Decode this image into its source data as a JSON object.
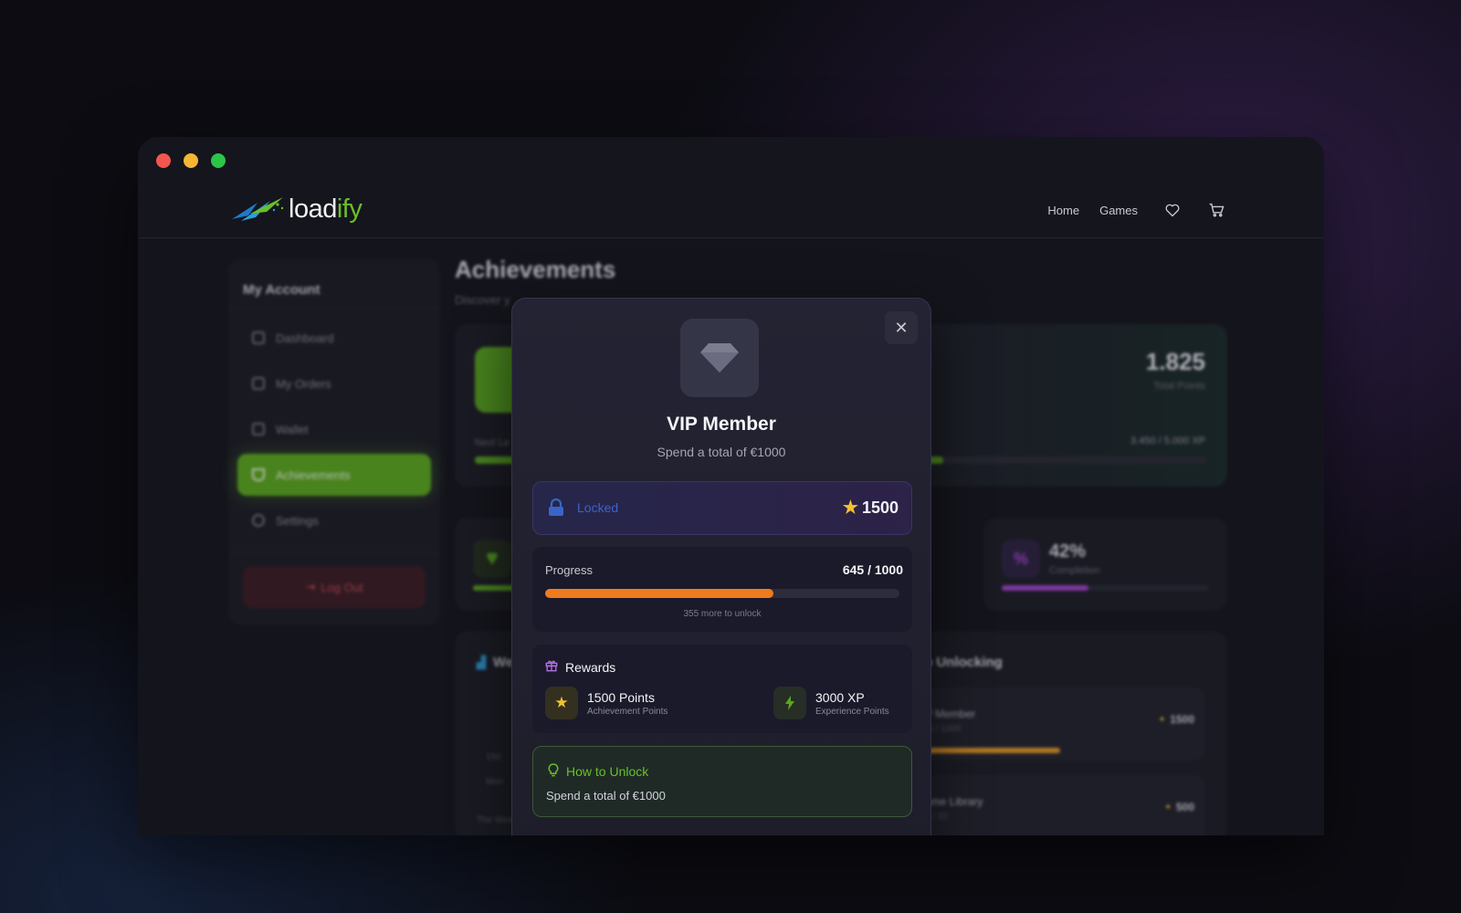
{
  "brand": {
    "name_prefix": "load",
    "name_suffix": "ify"
  },
  "nav": {
    "home": "Home",
    "games": "Games",
    "wishlist_icon": "heart-icon",
    "cart_icon": "cart-icon"
  },
  "sidebar": {
    "title": "My Account",
    "items": [
      {
        "label": "Dashboard",
        "icon": "grid-icon"
      },
      {
        "label": "My Orders",
        "icon": "receipt-icon"
      },
      {
        "label": "Wallet",
        "icon": "wallet-icon"
      },
      {
        "label": "Achievements",
        "icon": "trophy-icon",
        "active": true
      },
      {
        "label": "Settings",
        "icon": "gear-icon"
      }
    ],
    "logout": "Log Out"
  },
  "page": {
    "title": "Achievements",
    "subtitle": "Discover y"
  },
  "hero": {
    "points": "1.825",
    "points_label": "Total Points",
    "next_level_label": "Next Le",
    "xp": "3.450 / 5.000 XP",
    "xp_progress": 0.64
  },
  "stats": [
    {
      "value": "42%",
      "label": "Completion",
      "progress": 0.42,
      "color": "#a044c8"
    }
  ],
  "bg_cards": {
    "left_title": "We",
    "left_axis": [
      "150",
      "Mon"
    ],
    "left_footer": "The Wee",
    "right_title": "to Unlocking",
    "items": [
      {
        "name": "P Member",
        "sub": "% / 1000",
        "points": "1500"
      },
      {
        "name": "ame Library",
        "sub": "s / 10",
        "points": "500"
      }
    ]
  },
  "modal": {
    "icon": "diamond-icon",
    "title": "VIP Member",
    "subtitle": "Spend a total of €1000",
    "status": "Locked",
    "reward_points": "1500",
    "progress_label": "Progress",
    "progress_value": "645 / 1000",
    "progress_fraction": 0.645,
    "progress_note": "355 more to unlock",
    "rewards_title": "Rewards",
    "rewards": [
      {
        "name": "1500 Points",
        "sub": "Achievement Points",
        "icon": "star-icon"
      },
      {
        "name": "3000 XP",
        "sub": "Experience Points",
        "icon": "bolt-icon"
      }
    ],
    "howto_title": "How to Unlock",
    "howto_text": "Spend a total of €1000",
    "close_icon": "close-icon"
  },
  "colors": {
    "accent": "#5aa81f",
    "progress": "#f07a1e",
    "locked": "#3a64c8",
    "star": "#f2c12e"
  }
}
